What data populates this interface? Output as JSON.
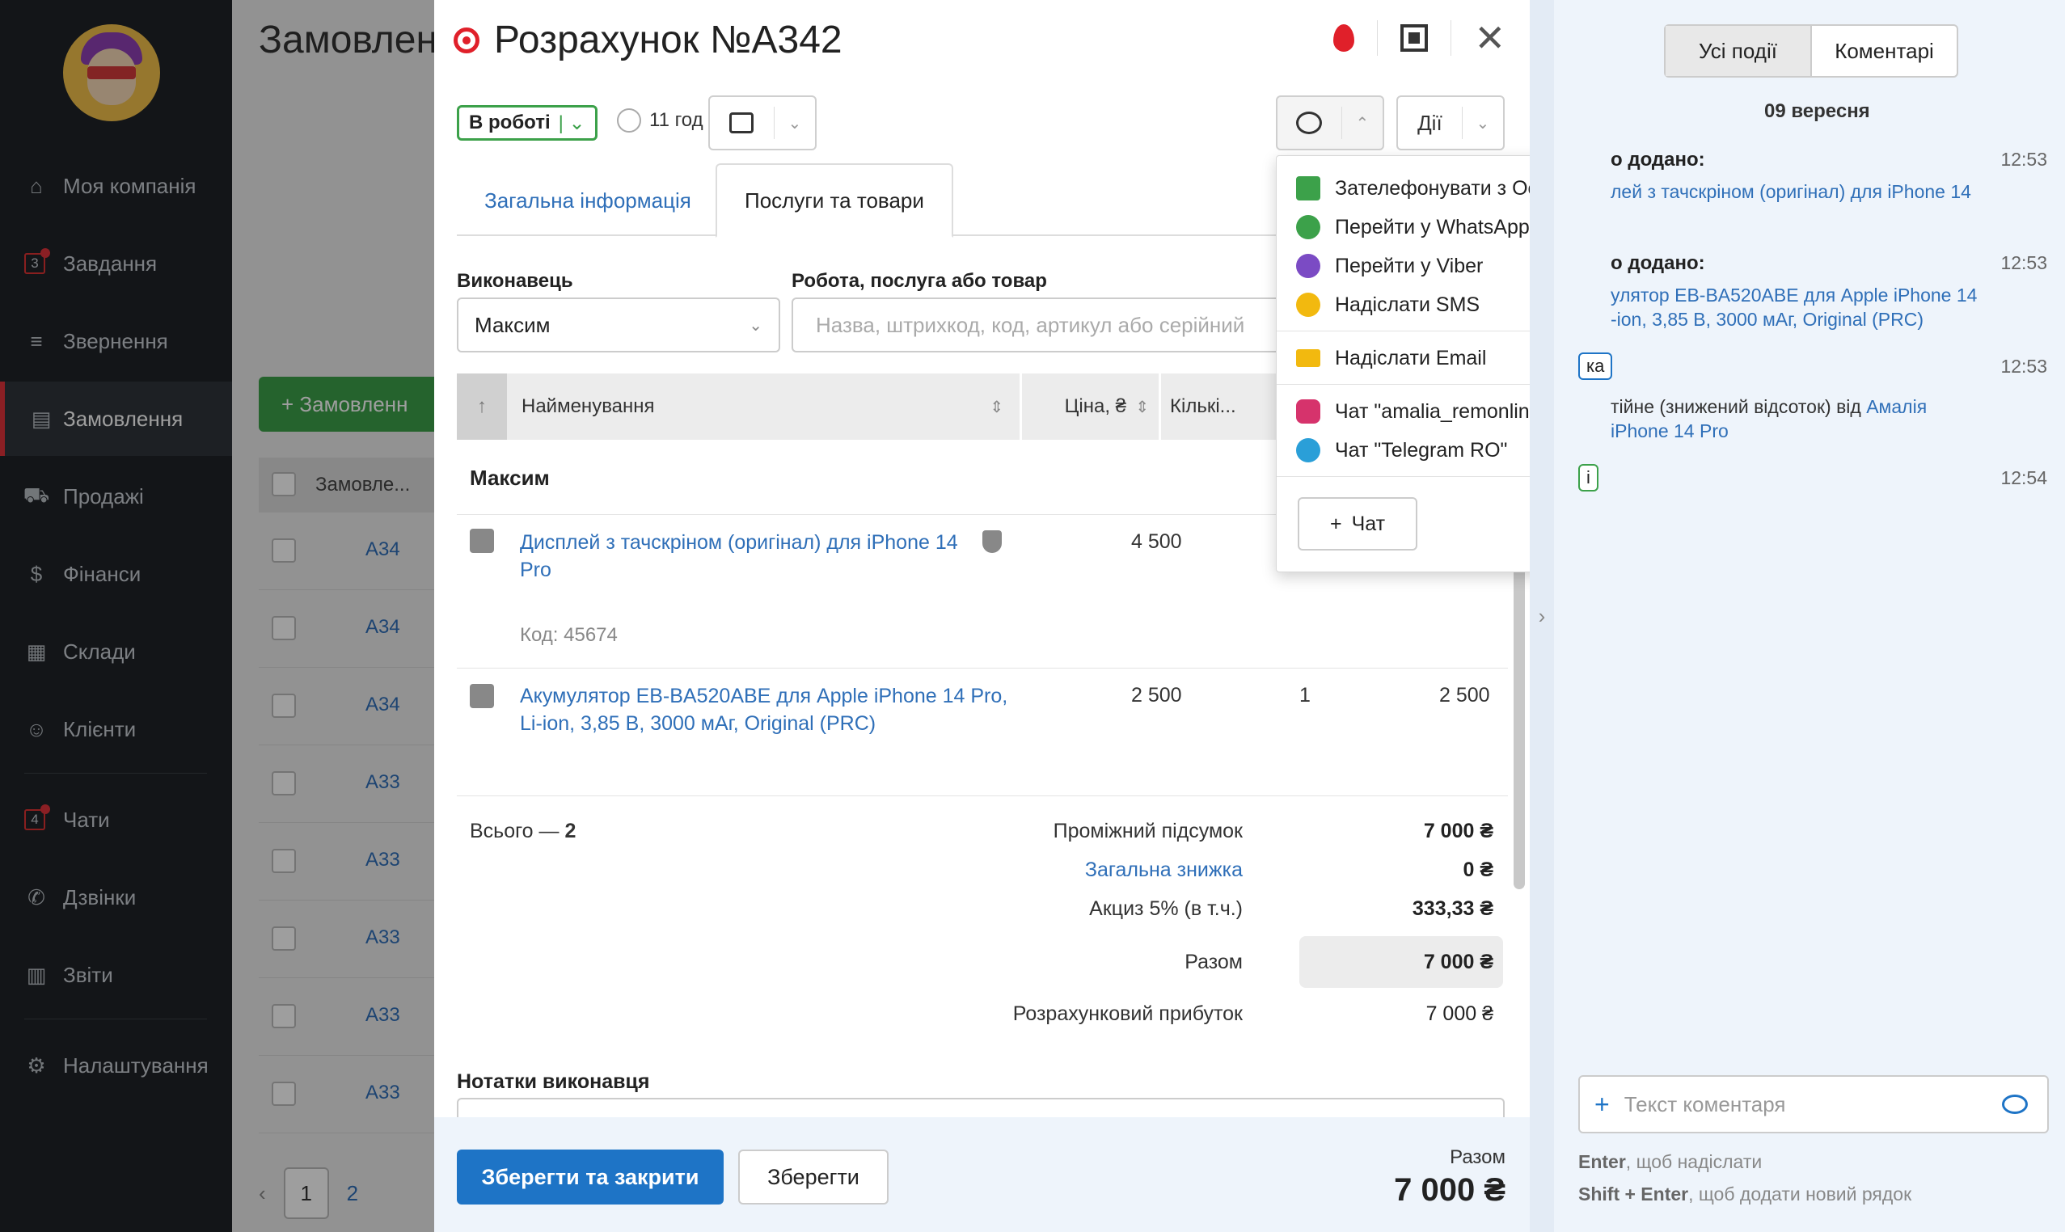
{
  "sidebar": {
    "items": [
      {
        "label": "Моя компанія",
        "icon": "home-icon"
      },
      {
        "label": "Завдання",
        "icon": "tasks-icon",
        "badge": "3"
      },
      {
        "label": "Звернення",
        "icon": "filter-icon"
      },
      {
        "label": "Замовлення",
        "icon": "orders-icon"
      },
      {
        "label": "Продажі",
        "icon": "cart-icon"
      },
      {
        "label": "Фінанси",
        "icon": "money-icon"
      },
      {
        "label": "Склади",
        "icon": "warehouse-icon"
      },
      {
        "label": "Клієнти",
        "icon": "clients-icon"
      },
      {
        "label": "Чати",
        "icon": "chats-icon",
        "badge": "4"
      },
      {
        "label": "Дзвінки",
        "icon": "phone-icon"
      },
      {
        "label": "Звіти",
        "icon": "reports-icon"
      },
      {
        "label": "Налаштування",
        "icon": "gear-icon"
      }
    ],
    "active": "Замовлення"
  },
  "bg_page": {
    "title": "Замовлен",
    "add_button": "+ Замовленн",
    "column": "Замовле...",
    "rows": [
      "A34",
      "A34",
      "A34",
      "A33",
      "A33",
      "A33",
      "A33",
      "A33"
    ],
    "pager": [
      "1",
      "2"
    ]
  },
  "modal": {
    "title": "Розрахунок №A342",
    "status": "В роботі",
    "timer": "11 год",
    "actions_label": "Дії",
    "tabs": [
      "Загальна інформація",
      "Послуги та товари"
    ],
    "executor_label": "Виконавець",
    "executor_value": "Максим",
    "work_label": "Робота, послуга або товар",
    "search_placeholder": "Назва, штрихкод, код, артикул або серійний",
    "columns": [
      "Найменування",
      "Ціна, ₴",
      "Кількі..."
    ],
    "group": "Максим",
    "items": [
      {
        "name_line1": "Дисплей з тачскріном (оригінал) для iPhone 14",
        "name_line2": "Pro",
        "price": "4 500",
        "qty": "",
        "total": "",
        "code": "Код: 45674"
      },
      {
        "name_line1": "Акумулятор EB-BA520ABE для Apple iPhone 14 Pro,",
        "name_line2": "Li-ion, 3,85 В, 3000 мАг, Original (PRC)",
        "price": "2 500",
        "qty": "1",
        "total": "2 500",
        "code": ""
      }
    ],
    "count_label": "Всього — ",
    "count_value": "2",
    "summary": {
      "subtotal_label": "Проміжний підсумок",
      "subtotal": "7 000 ₴",
      "discount_label": "Загальна знижка",
      "discount": "0 ₴",
      "excise_label": "Акциз 5% (в т.ч.)",
      "excise": "333,33 ₴",
      "total_label": "Разом",
      "total": "7 000 ₴",
      "profit_label": "Розрахунковий прибуток",
      "profit": "7 000 ₴"
    },
    "notes_label": "Нотатки виконавця",
    "footer": {
      "save_close": "Зберегти та закрити",
      "save": "Зберегти",
      "total_label": "Разом",
      "total": "7 000 ₴"
    }
  },
  "dropdown": {
    "items": [
      {
        "label": "Зателефонувати з Основна",
        "icon": "phone-icon",
        "color": "#3ca14a"
      },
      {
        "label": "Перейти у WhatsApp",
        "icon": "whatsapp-icon",
        "color": "#3ca14a",
        "external": true
      },
      {
        "label": "Перейти у Viber",
        "icon": "viber-icon",
        "color": "#7b4bc4",
        "external": true
      },
      {
        "label": "Надіслати SMS",
        "icon": "sms-icon",
        "color": "#f2b90f"
      },
      {
        "label": "Надіслати Email",
        "icon": "email-icon",
        "color": "#f2b90f"
      },
      {
        "label": "Чат \"amalia_remonline\"",
        "icon": "instagram-icon",
        "color": "#d6336c"
      },
      {
        "label": "Чат \"Telegram RO\"",
        "icon": "telegram-icon",
        "color": "#2a9fd8"
      }
    ],
    "chat_button": "Чат"
  },
  "events": {
    "tabs": [
      "Усі події",
      "Коментарі"
    ],
    "date": "09 вересня",
    "entries": [
      {
        "title": "о додано:",
        "time": "12:53",
        "text": "лей з тачскріном (оригінал) для iPhone 14"
      },
      {
        "title": "о додано:",
        "time": "12:53",
        "text1": "улятор EB-BA520ABE для Apple iPhone 14",
        "text2": "-ion, 3,85 В, 3000 мАг, Original (PRC)"
      },
      {
        "chip": "ка",
        "time": "12:53",
        "text1_dark": "тійне (знижений відсоток) від ",
        "text1_link": "Амалія",
        "text2": "iPhone 14 Pro"
      },
      {
        "chip": "і",
        "time": "12:54"
      }
    ],
    "comment_placeholder": "Текст коментаря",
    "hint1_key": "Enter",
    "hint1_text": ", щоб надіслати",
    "hint2_key": "Shift + Enter",
    "hint2_text": ", щоб додати новий рядок"
  }
}
